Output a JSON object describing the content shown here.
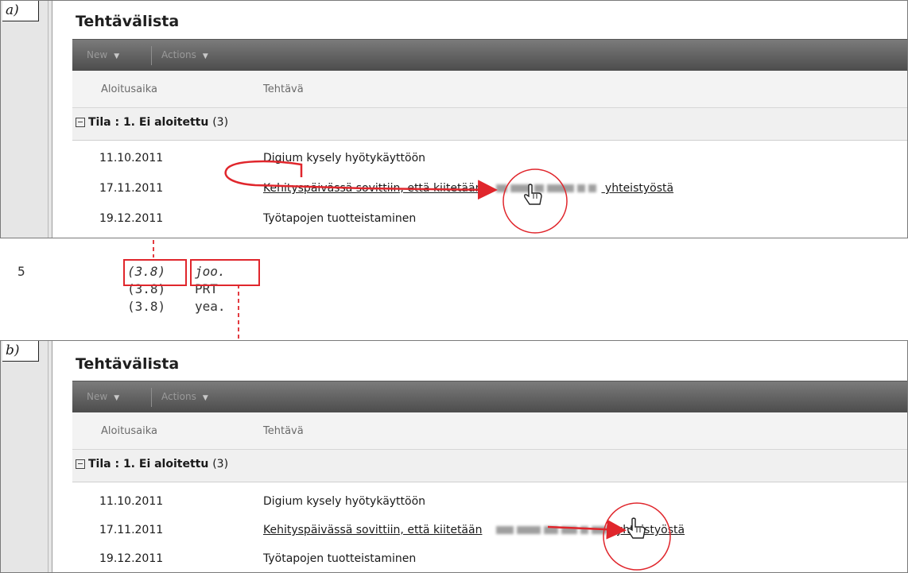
{
  "panel_a": {
    "label": "a)",
    "app_title": "Tehtävälista",
    "toolbar": {
      "new_label": "New",
      "actions_label": "Actions"
    },
    "columns": {
      "start": "Aloitusaika",
      "task": "Tehtävä"
    },
    "group": {
      "label": "Tila : 1. Ei aloitettu",
      "count": "(3)"
    },
    "rows": [
      {
        "date": "11.10.2011",
        "task": "Digium kysely hyötykäyttöön"
      },
      {
        "date": "17.11.2011",
        "task_start": "Kehityspäivässä sovittiin, että kiitetään",
        "task_end": "yhteistyöstä"
      },
      {
        "date": "19.12.2011",
        "task": "Työtapojen tuotteistaminen"
      }
    ]
  },
  "transcript": {
    "line_number": "5",
    "lines": [
      {
        "time": "(3.8)",
        "word": "joo."
      },
      {
        "time": "(3.8)",
        "word": "PRT"
      },
      {
        "time": "(3.8)",
        "word": "yea."
      }
    ]
  },
  "panel_b": {
    "label": "b)",
    "app_title": "Tehtävälista",
    "toolbar": {
      "new_label": "New",
      "actions_label": "Actions"
    },
    "columns": {
      "start": "Aloitusaika",
      "task": "Tehtävä"
    },
    "group": {
      "label": "Tila : 1. Ei aloitettu",
      "count": "(3)"
    },
    "rows": [
      {
        "date": "11.10.2011",
        "task": "Digium kysely hyötykäyttöön"
      },
      {
        "date": "17.11.2011",
        "task_start": "Kehityspäivässä sovittiin, että kiitetään",
        "task_end": "yhteistyöstä"
      },
      {
        "date": "19.12.2011",
        "task": "Työtapojen tuotteistaminen"
      }
    ]
  },
  "colors": {
    "annotation": "#e0262c",
    "toolbar": "#5a5a5a"
  },
  "icons": [
    "hand-pointer-icon",
    "collapse-box-icon",
    "dropdown-arrow-icon"
  ]
}
